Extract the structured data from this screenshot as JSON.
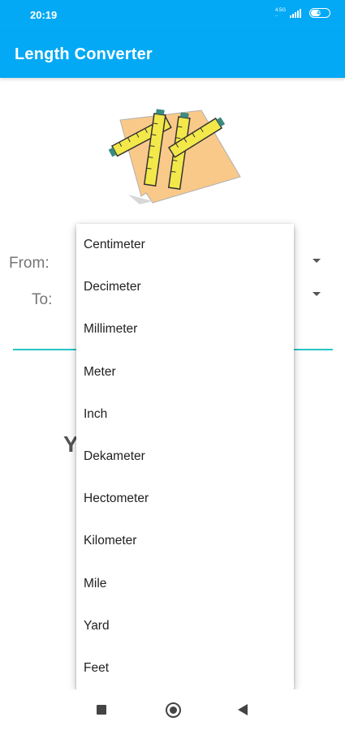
{
  "status_bar": {
    "time": "20:19",
    "network_top": "4.5G",
    "network_bottom": "..",
    "battery": "49"
  },
  "app_bar": {
    "title": "Length Converter"
  },
  "form": {
    "from_label": "From:",
    "to_label": "To:",
    "result_partial": "Y"
  },
  "dropdown": {
    "items": [
      "Centimeter",
      "Decimeter",
      "Millimeter",
      "Meter",
      "Inch",
      "Dekameter",
      "Hectometer",
      "Kilometer",
      "Mile",
      "Yard",
      "Feet"
    ]
  },
  "icons": {
    "logo": "rulers-logo",
    "nav": [
      "recents-square-icon",
      "home-circle-icon",
      "back-triangle-icon"
    ]
  },
  "colors": {
    "primary": "#03a9f4",
    "underline": "#26c6c6",
    "logo_background": "#f9c98a",
    "ruler": "#f3e84a"
  }
}
